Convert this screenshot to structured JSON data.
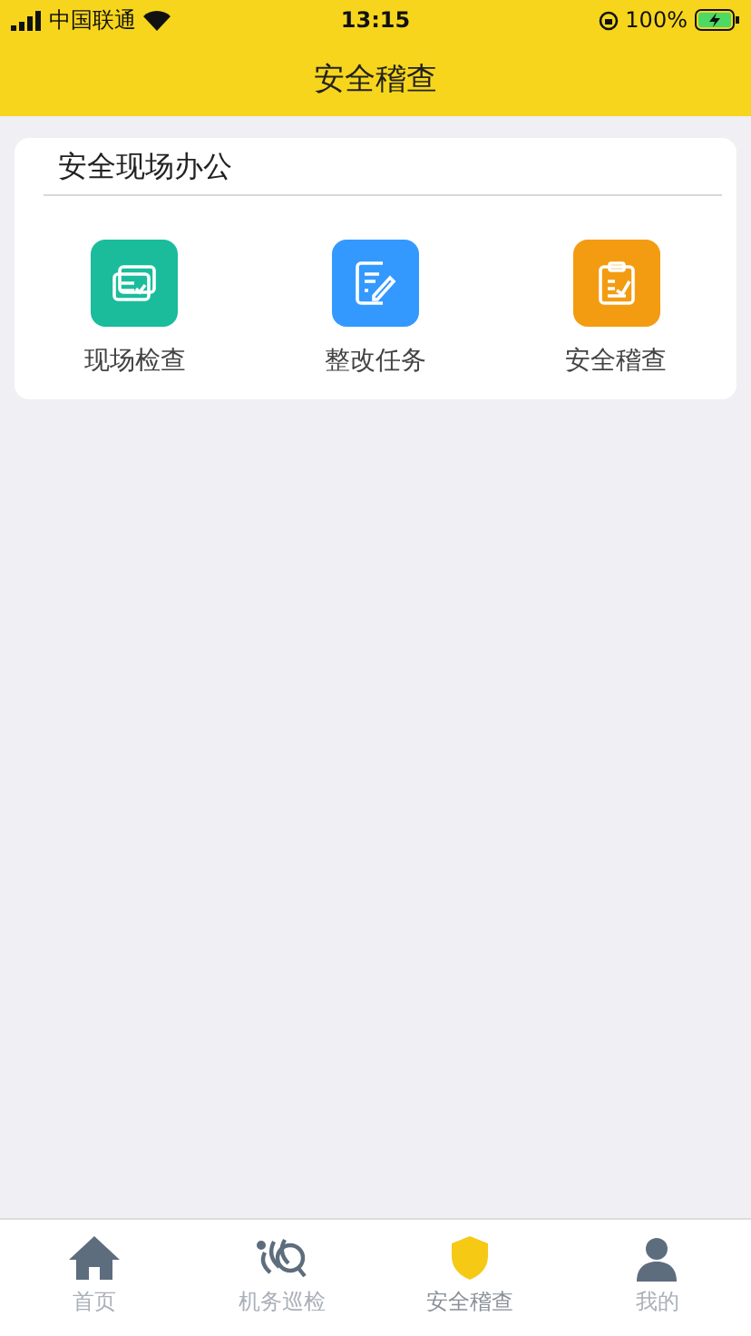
{
  "status_bar": {
    "carrier": "中国联通",
    "time": "13:15",
    "battery": "100%"
  },
  "header": {
    "title": "安全稽查"
  },
  "section": {
    "title": "安全现场办公",
    "items": [
      {
        "label": "现场检查",
        "kind": "cards",
        "color": "#1abc9c"
      },
      {
        "label": "整改任务",
        "kind": "edit",
        "color": "#3399ff"
      },
      {
        "label": "安全稽查",
        "kind": "clipboard",
        "color": "#f39c12"
      }
    ]
  },
  "tab_bar": [
    {
      "label": "首页",
      "kind": "home",
      "selected": false
    },
    {
      "label": "机务巡检",
      "kind": "patrol",
      "selected": false
    },
    {
      "label": "安全稽查",
      "kind": "shield",
      "selected": true
    },
    {
      "label": "我的",
      "kind": "person",
      "selected": false
    }
  ]
}
